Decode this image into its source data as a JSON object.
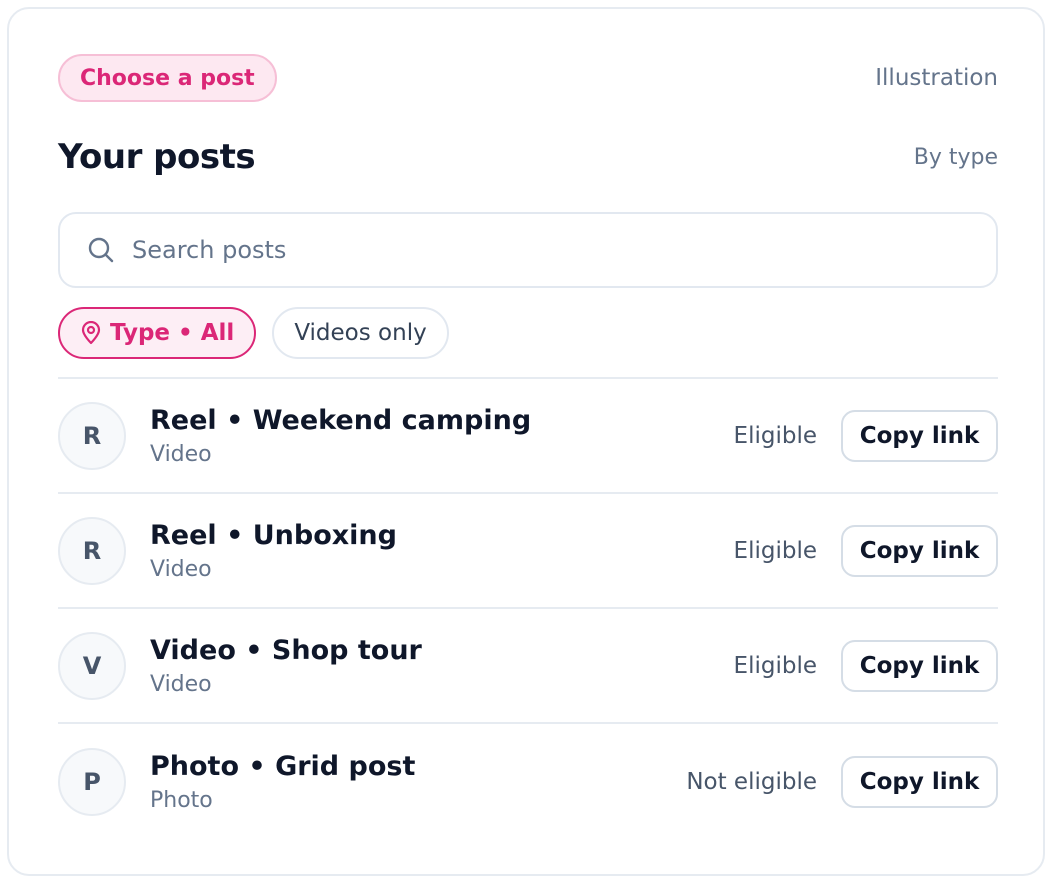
{
  "header": {
    "choose_pill": "Choose a post",
    "illustration_label": "Illustration",
    "title": "Your posts",
    "sort_label": "By type"
  },
  "search": {
    "icon": "search-icon",
    "placeholder": "Search posts",
    "value": ""
  },
  "filters": [
    {
      "label": "Type • All",
      "icon": "pin-icon",
      "active": true
    },
    {
      "label": "Videos only",
      "active": false
    }
  ],
  "posts": [
    {
      "avatar": "R",
      "title": "Reel • Weekend camping",
      "type": "Video",
      "status": "Eligible",
      "action": "Copy link"
    },
    {
      "avatar": "R",
      "title": "Reel • Unboxing",
      "type": "Video",
      "status": "Eligible",
      "action": "Copy link"
    },
    {
      "avatar": "V",
      "title": "Video • Shop tour",
      "type": "Video",
      "status": "Eligible",
      "action": "Copy link"
    },
    {
      "avatar": "P",
      "title": "Photo • Grid post",
      "type": "Photo",
      "status": "Not eligible",
      "action": "Copy link"
    }
  ],
  "colors": {
    "accent": "#db2777",
    "accent_bg": "#fde8f1",
    "text": "#0f172a",
    "muted": "#64748b",
    "border": "#e2e8f0"
  }
}
